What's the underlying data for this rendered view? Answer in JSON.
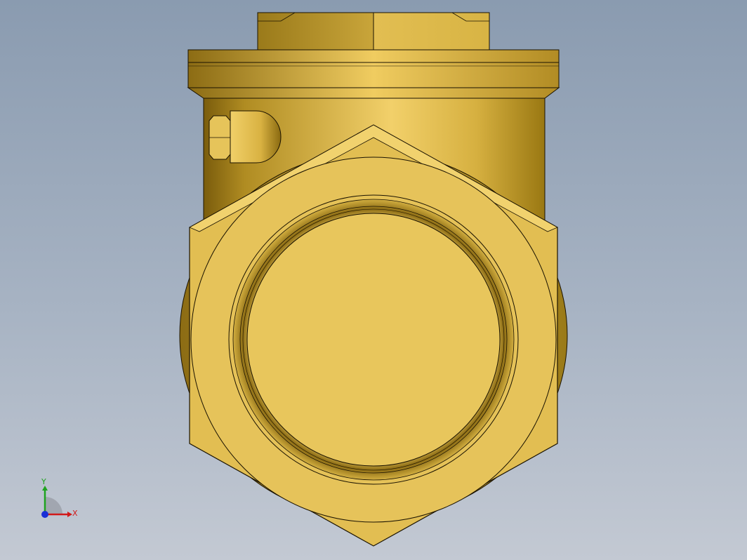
{
  "viewport": {
    "background_top": "#8a9bb0",
    "background_bottom": "#c3c9d3"
  },
  "model": {
    "brass_light": "#f0cf68",
    "brass_mid": "#e6c35a",
    "brass_dark": "#a6821a",
    "edge_color": "#1a1200"
  },
  "triad": {
    "x_label": "X",
    "y_label": "Y",
    "x_color": "#d11a1a",
    "y_color": "#1ea31e",
    "z_color": "#1a2fd6"
  }
}
